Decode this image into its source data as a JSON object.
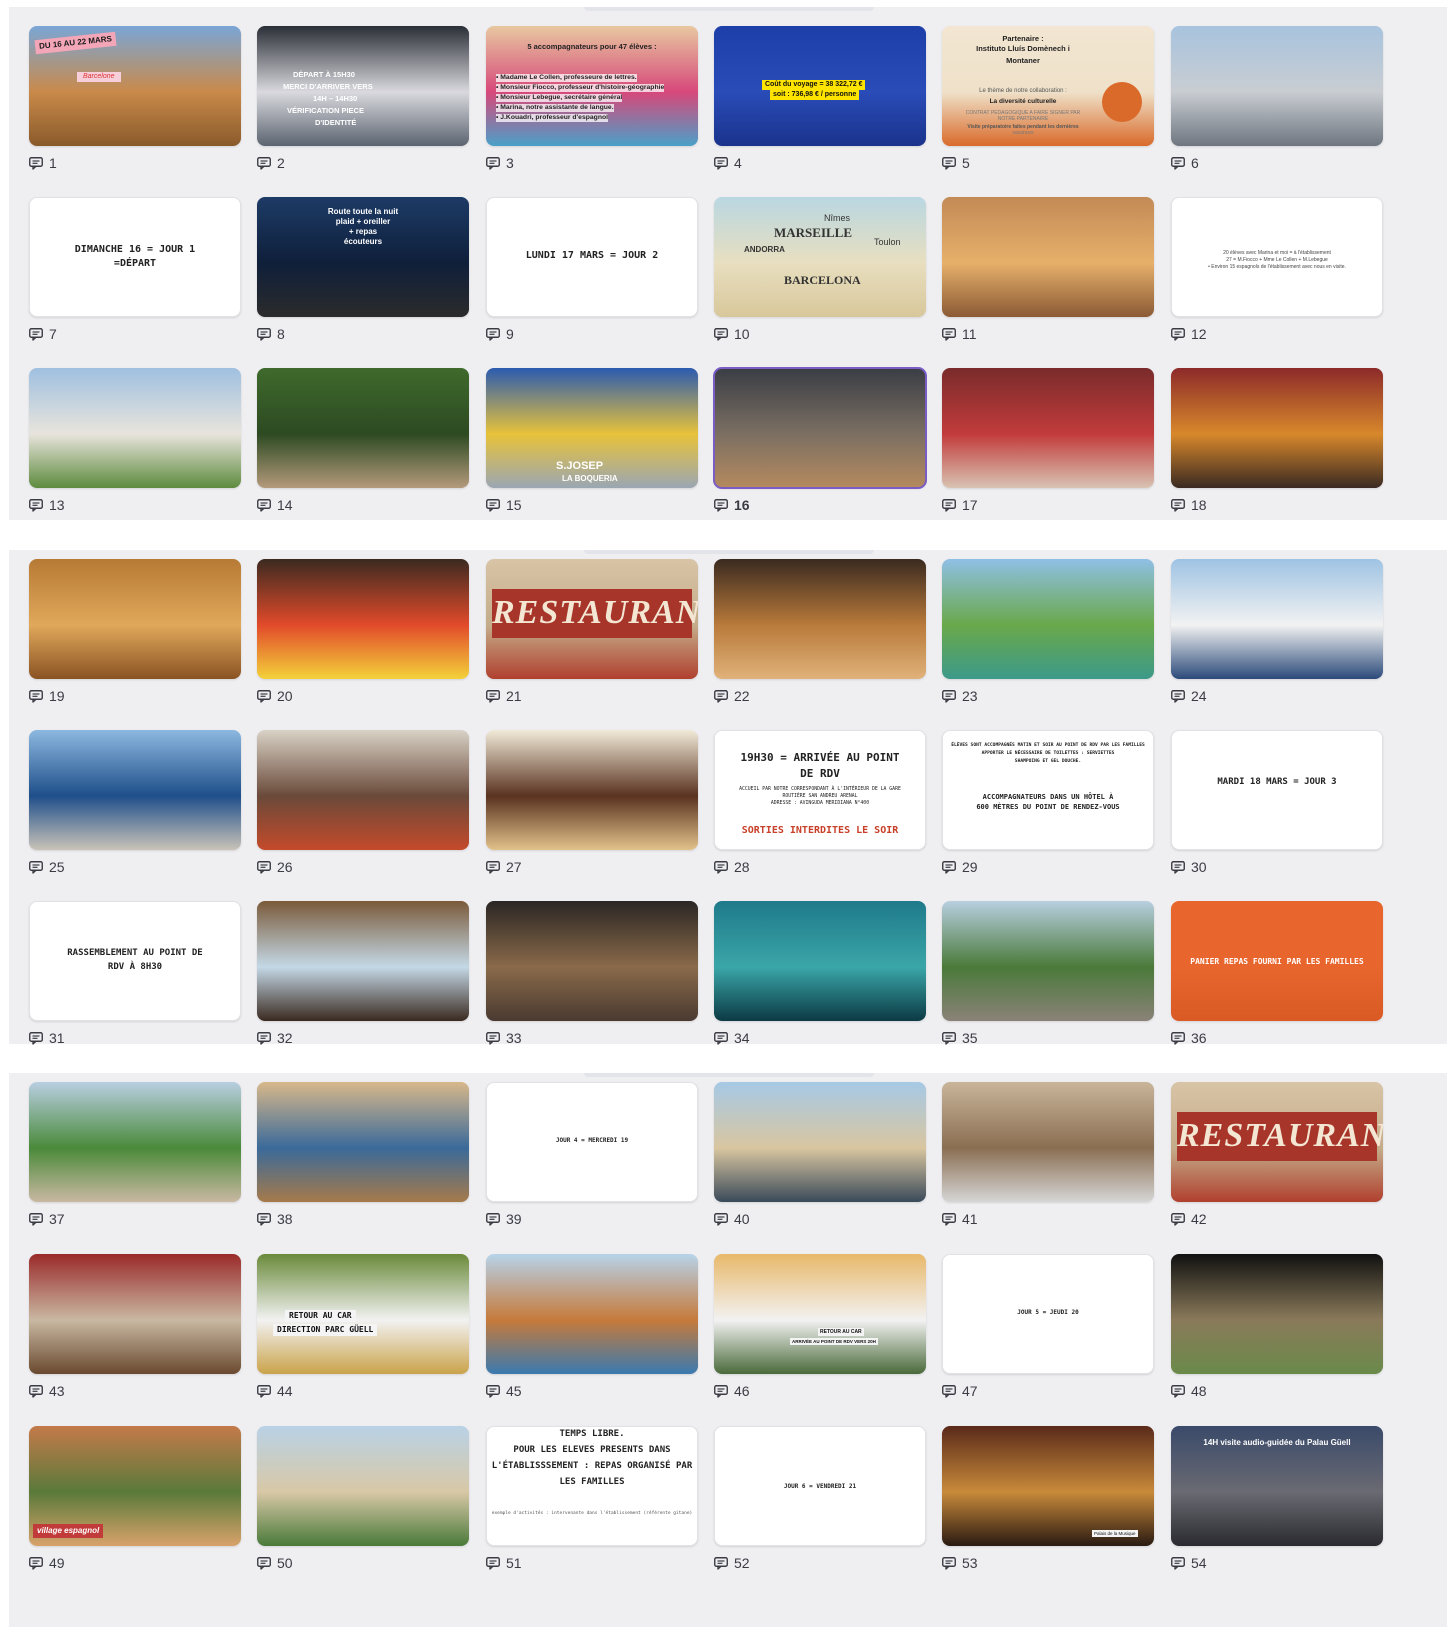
{
  "slides": [
    {
      "num": "1",
      "style": "photo",
      "colors": [
        "#7aa6d6",
        "#c98a4a",
        "#8a5a2b"
      ],
      "texts": [
        "DU 16 AU 22 MARS",
        "Barcelone"
      ],
      "icon": "notes-icon"
    },
    {
      "num": "2",
      "style": "photo",
      "colors": [
        "#2a2e36",
        "#d9d9de",
        "#5b6470"
      ],
      "texts": [
        "DÉPART À 15H30",
        "MERCI D'ARRIVER VERS",
        "14H – 14H30",
        "VÉRIFICATION PIECE",
        "D'IDENTITÉ"
      ],
      "icon": "notes-icon"
    },
    {
      "num": "3",
      "style": "photo",
      "colors": [
        "#e8c8a0",
        "#d7487a",
        "#4aa0c8"
      ],
      "texts": [
        "5 accompagnateurs pour 47 élèves :",
        "• Madame Le Collen, professeure de lettres.",
        "• Monsieur Fiocco, professeur d'histoire-géographie",
        "• Monsieur Lebegue, secrétaire général",
        "• Marina, notre assistante de langue.",
        "• J.Kouadri, professeur d'espagnol"
      ],
      "icon": "notes-icon"
    },
    {
      "num": "4",
      "style": "photo",
      "colors": [
        "#1d3fa8",
        "#2a4cb8",
        "#1a338c"
      ],
      "texts": [
        "Coût du voyage = 38 322,72 €",
        "soit : 736,98 € / personne"
      ],
      "icon": "notes-icon"
    },
    {
      "num": "5",
      "style": "photo",
      "colors": [
        "#f2e6d2",
        "#efe1c9",
        "#d96a2a"
      ],
      "texts": [
        "Partenaire :",
        "Instituto Lluís Domènech i",
        "Montaner",
        "Le thème de notre collaboration :",
        "La diversité culturelle",
        "CONTRAT PEDAGOGIQUE A FAIRE SIGNER PAR",
        "NOTRE PARTENAIRE",
        "Visite préparatoire faites pendant les dernières",
        "vacances"
      ],
      "icon": "notes-icon"
    },
    {
      "num": "6",
      "style": "photo",
      "colors": [
        "#a7c3de",
        "#c9cdd2",
        "#6e7680"
      ],
      "texts": [],
      "icon": "notes-icon"
    },
    {
      "num": "7",
      "style": "white",
      "colors": [
        "#ffffff"
      ],
      "texts": [
        "DIMANCHE 16 = JOUR 1",
        "=DÉPART"
      ],
      "icon": "notes-icon"
    },
    {
      "num": "8",
      "style": "photo",
      "colors": [
        "#1d3b66",
        "#0f1f3a",
        "#2b2b2b"
      ],
      "texts": [
        "Route toute la nuit",
        "plaid + oreiller",
        "+ repas",
        "écouteurs"
      ],
      "icon": "notes-icon"
    },
    {
      "num": "9",
      "style": "white",
      "colors": [
        "#ffffff"
      ],
      "texts": [
        "LUNDI 17 MARS = JOUR 2"
      ],
      "icon": "notes-icon"
    },
    {
      "num": "10",
      "style": "photo",
      "colors": [
        "#b9d7e2",
        "#e8dfc0",
        "#d8c79a"
      ],
      "texts": [
        "MARSEILLE",
        "BARCELONA",
        "ANDORRA",
        "Toulon",
        "Nîmes"
      ],
      "icon": "notes-icon"
    },
    {
      "num": "11",
      "style": "photo",
      "colors": [
        "#c38a56",
        "#e6b06a",
        "#8b5a35"
      ],
      "texts": [],
      "icon": "notes-icon"
    },
    {
      "num": "12",
      "style": "white",
      "colors": [
        "#ffffff"
      ],
      "texts": [
        "20 élèves avec Marina et moi = à l'établissement",
        "27 = M.Fiocco + Mme Le Collen + M.Lebegue",
        "• Environ 15 espagnols de l'établissement avec nous en visite."
      ],
      "icon": "notes-icon"
    },
    {
      "num": "13",
      "style": "photo",
      "colors": [
        "#9fc0e0",
        "#e8e4dc",
        "#5d8b3e"
      ],
      "texts": [],
      "icon": "notes-icon"
    },
    {
      "num": "14",
      "style": "photo",
      "colors": [
        "#3f6a2c",
        "#2d4a22",
        "#b49a7c"
      ],
      "texts": [],
      "icon": "notes-icon"
    },
    {
      "num": "15",
      "style": "photo",
      "colors": [
        "#2b5bb0",
        "#e8c23a",
        "#9aa6b3"
      ],
      "texts": [
        "S.JOSEP",
        "LA BOQUERIA"
      ],
      "icon": "notes-icon"
    },
    {
      "num": "16",
      "style": "photo",
      "colors": [
        "#3a3d45",
        "#7b6f62",
        "#b58a5e"
      ],
      "texts": [],
      "icon": "notes-icon",
      "selected": true
    },
    {
      "num": "17",
      "style": "photo",
      "colors": [
        "#7a2b2b",
        "#c23b3b",
        "#d8c3b2"
      ],
      "texts": [],
      "icon": "notes-icon"
    },
    {
      "num": "18",
      "style": "photo",
      "colors": [
        "#8c2a2a",
        "#d8882b",
        "#3a2a22"
      ],
      "texts": [],
      "icon": "notes-icon"
    },
    {
      "num": "19",
      "style": "photo",
      "colors": [
        "#b77a35",
        "#e0a85a",
        "#8a5323"
      ],
      "texts": [],
      "icon": "notes-icon"
    },
    {
      "num": "20",
      "style": "photo",
      "colors": [
        "#3b2a20",
        "#e24a2a",
        "#f3d23a"
      ],
      "texts": [],
      "icon": "notes-icon"
    },
    {
      "num": "21",
      "style": "photo",
      "colors": [
        "#d8c4a6",
        "#c4ac8a",
        "#b0402e"
      ],
      "texts": [
        "RESTAURANTE"
      ],
      "icon": "notes-icon"
    },
    {
      "num": "22",
      "style": "photo",
      "colors": [
        "#3a2a20",
        "#b97a3a",
        "#e0b27a"
      ],
      "texts": [],
      "icon": "notes-icon"
    },
    {
      "num": "23",
      "style": "photo",
      "colors": [
        "#8fc0e6",
        "#6aa84a",
        "#3c9a8a"
      ],
      "texts": [],
      "icon": "notes-icon"
    },
    {
      "num": "24",
      "style": "photo",
      "colors": [
        "#9ec3e3",
        "#f2f2f2",
        "#2b4a7a"
      ],
      "texts": [],
      "icon": "notes-icon"
    },
    {
      "num": "25",
      "style": "photo",
      "colors": [
        "#8cb8e0",
        "#1f4f8a",
        "#c9c3b8"
      ],
      "texts": [],
      "icon": "notes-icon"
    },
    {
      "num": "26",
      "style": "photo",
      "colors": [
        "#d9d2c6",
        "#6a4a3a",
        "#c44a2a"
      ],
      "texts": [],
      "icon": "notes-icon"
    },
    {
      "num": "27",
      "style": "photo",
      "colors": [
        "#f1ead8",
        "#5a3220",
        "#e2c28a"
      ],
      "texts": [],
      "icon": "notes-icon"
    },
    {
      "num": "28",
      "style": "white",
      "colors": [
        "#ffffff"
      ],
      "texts": [
        "19H30 = ARRIVÉE AU POINT",
        "DE RDV",
        "ACCUEIL PAR NOTRE CORRESPONDANT À L'INTÉRIEUR DE LA GARE",
        "ROUTIÈRE SAN ANDREU ARENAL",
        "ADRESSE : AVINGUDA MERIDIANA N°400",
        "SORTIES INTERDITES LE SOIR"
      ],
      "icon": "notes-icon"
    },
    {
      "num": "29",
      "style": "white",
      "colors": [
        "#ffffff"
      ],
      "texts": [
        "ÉLÈVES SONT ACCOMPAGNÉS MATIN ET SOIR AU POINT DE RDV PAR LES FAMILLES",
        "APPORTER LE NÉCESSAIRE DE TOILETTES : SERVIETTES",
        "SHAMPOING ET GEL DOUCHE.",
        "ACCOMPAGNATEURS DANS UN HÔTEL À",
        "600 MÈTRES DU POINT DE RENDEZ-VOUS"
      ],
      "icon": "notes-icon"
    },
    {
      "num": "30",
      "style": "white",
      "colors": [
        "#ffffff"
      ],
      "texts": [
        "MARDI 18 MARS = JOUR 3"
      ],
      "icon": "notes-icon"
    },
    {
      "num": "31",
      "style": "white",
      "colors": [
        "#ffffff"
      ],
      "texts": [
        "RASSEMBLEMENT AU POINT DE",
        "RDV À 8H30"
      ],
      "icon": "notes-icon"
    },
    {
      "num": "32",
      "style": "photo",
      "colors": [
        "#7a5a3a",
        "#c4d8e6",
        "#3a2a20"
      ],
      "texts": [],
      "icon": "notes-icon"
    },
    {
      "num": "33",
      "style": "photo",
      "colors": [
        "#2a2624",
        "#8a6a4a",
        "#4a3a30"
      ],
      "texts": [],
      "icon": "notes-icon"
    },
    {
      "num": "34",
      "style": "photo",
      "colors": [
        "#1f7a8a",
        "#3aa6a8",
        "#0c3a44"
      ],
      "texts": [],
      "icon": "notes-icon"
    },
    {
      "num": "35",
      "style": "photo",
      "colors": [
        "#b8cfe0",
        "#4a7a3a",
        "#8a8278"
      ],
      "texts": [],
      "icon": "notes-icon"
    },
    {
      "num": "36",
      "style": "photo",
      "colors": [
        "#e8662e",
        "#e8662e",
        "#d95a24"
      ],
      "texts": [
        "PANIER REPAS FOURNI PAR LES FAMILLES"
      ],
      "icon": "notes-icon"
    },
    {
      "num": "37",
      "style": "photo",
      "colors": [
        "#b9cfe2",
        "#4a8a3a",
        "#c9b8a2"
      ],
      "texts": [],
      "icon": "notes-icon"
    },
    {
      "num": "38",
      "style": "photo",
      "colors": [
        "#d8b88a",
        "#3a6a9a",
        "#a67a4a"
      ],
      "texts": [],
      "icon": "notes-icon"
    },
    {
      "num": "39",
      "style": "white",
      "colors": [
        "#ffffff"
      ],
      "texts": [
        "JOUR 4 = MERCREDI 19"
      ],
      "icon": "notes-icon"
    },
    {
      "num": "40",
      "style": "photo",
      "colors": [
        "#a6c9e6",
        "#d9c6a0",
        "#3a4a5a"
      ],
      "texts": [],
      "icon": "notes-icon"
    },
    {
      "num": "41",
      "style": "photo",
      "colors": [
        "#c9b59a",
        "#8a6e52",
        "#d6d6d6"
      ],
      "texts": [],
      "icon": "notes-icon"
    },
    {
      "num": "42",
      "style": "photo",
      "colors": [
        "#d8c4a6",
        "#c4ac8a",
        "#b0402e"
      ],
      "texts": [
        "RESTAURANTE"
      ],
      "icon": "notes-icon"
    },
    {
      "num": "43",
      "style": "photo",
      "colors": [
        "#9a2a2a",
        "#c9b8a2",
        "#6a4a30"
      ],
      "texts": [],
      "icon": "notes-icon"
    },
    {
      "num": "44",
      "style": "photo",
      "colors": [
        "#6a8a3a",
        "#f2f2f2",
        "#caa34a"
      ],
      "texts": [
        "RETOUR AU CAR",
        "DIRECTION PARC GÜELL"
      ],
      "icon": "notes-icon"
    },
    {
      "num": "45",
      "style": "photo",
      "colors": [
        "#b7d3ea",
        "#c67a3a",
        "#3a7ab0"
      ],
      "texts": [],
      "icon": "notes-icon"
    },
    {
      "num": "46",
      "style": "photo",
      "colors": [
        "#e8b86a",
        "#f2f2f2",
        "#4a6a3a"
      ],
      "texts": [
        "RETOUR AU CAR",
        "ARRIVÉE AU POINT DE RDV VERS 20H"
      ],
      "icon": "notes-icon"
    },
    {
      "num": "47",
      "style": "white",
      "colors": [
        "#ffffff"
      ],
      "texts": [
        "JOUR 5 = JEUDI 20"
      ],
      "icon": "notes-icon"
    },
    {
      "num": "48",
      "style": "photo",
      "colors": [
        "#111111",
        "#8a7a5a",
        "#6a8a4a"
      ],
      "texts": [],
      "icon": "notes-icon"
    },
    {
      "num": "49",
      "style": "photo",
      "colors": [
        "#c47a4a",
        "#5a7a3a",
        "#d8a26a"
      ],
      "texts": [
        "village espagnol"
      ],
      "icon": "notes-icon"
    },
    {
      "num": "50",
      "style": "photo",
      "colors": [
        "#b9d2e6",
        "#d8c8a6",
        "#4a7a3a"
      ],
      "texts": [],
      "icon": "notes-icon"
    },
    {
      "num": "51",
      "style": "white",
      "colors": [
        "#ffffff"
      ],
      "texts": [
        "TEMPS LIBRE.",
        "POUR LES ELEVES PRESENTS DANS",
        "L'ÉTABLISSSEMENT : REPAS ORGANISÉ PAR",
        "LES FAMILLES",
        "exemple d'activités : intervenante dans l'établissement (référente gitane)"
      ],
      "icon": "notes-icon"
    },
    {
      "num": "52",
      "style": "white",
      "colors": [
        "#ffffff"
      ],
      "texts": [
        "JOUR 6 = VENDREDI 21"
      ],
      "icon": "notes-icon"
    },
    {
      "num": "53",
      "style": "photo",
      "colors": [
        "#5a2a1a",
        "#c88a3a",
        "#2a1a12"
      ],
      "texts": [
        "Palais de la Musique"
      ],
      "icon": "notes-icon"
    },
    {
      "num": "54",
      "style": "photo",
      "colors": [
        "#3a4a6a",
        "#6a6a72",
        "#2a2a30"
      ],
      "texts": [
        "14H visite audio-guidée du Palau Güell"
      ],
      "icon": "notes-icon"
    }
  ]
}
